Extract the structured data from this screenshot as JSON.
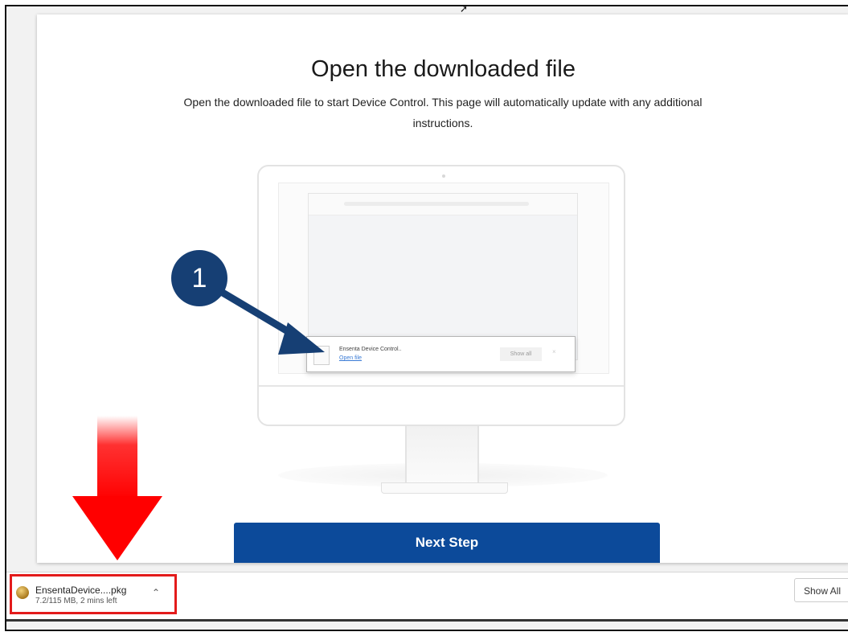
{
  "page": {
    "title": "Open the downloaded file",
    "subtitle": "Open the downloaded file to start Device Control. This page will automatically update with any additional instructions.",
    "next_button": "Next Step"
  },
  "illustration": {
    "step_number": "1",
    "popup_filename": "Ensenta Device Control..",
    "popup_open_link": "Open file",
    "popup_show_all": "Show all",
    "popup_close": "×"
  },
  "download_bar": {
    "filename": "EnsentaDevice....pkg",
    "status": "7.2/115 MB, 2 mins left",
    "show_all": "Show All"
  },
  "colors": {
    "primary_button": "#0c4a9a",
    "step_badge": "#163f74",
    "highlight_red": "#e31b1b"
  },
  "icons": [
    "pkg-file-icon",
    "chevron-up-icon",
    "red-down-arrow",
    "mouse-cursor-icon"
  ]
}
